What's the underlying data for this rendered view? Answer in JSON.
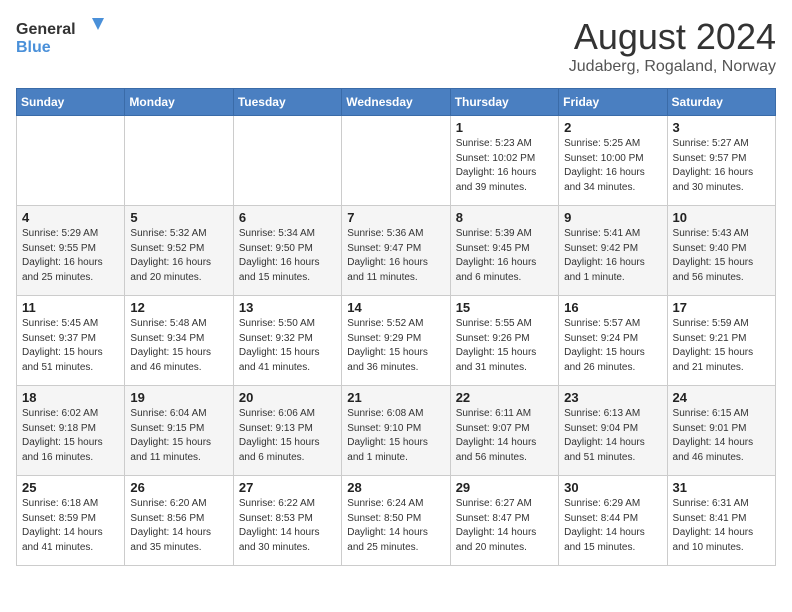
{
  "header": {
    "logo_general": "General",
    "logo_blue": "Blue",
    "month_year": "August 2024",
    "location": "Judaberg, Rogaland, Norway"
  },
  "days_of_week": [
    "Sunday",
    "Monday",
    "Tuesday",
    "Wednesday",
    "Thursday",
    "Friday",
    "Saturday"
  ],
  "weeks": [
    [
      {
        "day": "",
        "info": ""
      },
      {
        "day": "",
        "info": ""
      },
      {
        "day": "",
        "info": ""
      },
      {
        "day": "",
        "info": ""
      },
      {
        "day": "1",
        "info": "Sunrise: 5:23 AM\nSunset: 10:02 PM\nDaylight: 16 hours\nand 39 minutes."
      },
      {
        "day": "2",
        "info": "Sunrise: 5:25 AM\nSunset: 10:00 PM\nDaylight: 16 hours\nand 34 minutes."
      },
      {
        "day": "3",
        "info": "Sunrise: 5:27 AM\nSunset: 9:57 PM\nDaylight: 16 hours\nand 30 minutes."
      }
    ],
    [
      {
        "day": "4",
        "info": "Sunrise: 5:29 AM\nSunset: 9:55 PM\nDaylight: 16 hours\nand 25 minutes."
      },
      {
        "day": "5",
        "info": "Sunrise: 5:32 AM\nSunset: 9:52 PM\nDaylight: 16 hours\nand 20 minutes."
      },
      {
        "day": "6",
        "info": "Sunrise: 5:34 AM\nSunset: 9:50 PM\nDaylight: 16 hours\nand 15 minutes."
      },
      {
        "day": "7",
        "info": "Sunrise: 5:36 AM\nSunset: 9:47 PM\nDaylight: 16 hours\nand 11 minutes."
      },
      {
        "day": "8",
        "info": "Sunrise: 5:39 AM\nSunset: 9:45 PM\nDaylight: 16 hours\nand 6 minutes."
      },
      {
        "day": "9",
        "info": "Sunrise: 5:41 AM\nSunset: 9:42 PM\nDaylight: 16 hours\nand 1 minute."
      },
      {
        "day": "10",
        "info": "Sunrise: 5:43 AM\nSunset: 9:40 PM\nDaylight: 15 hours\nand 56 minutes."
      }
    ],
    [
      {
        "day": "11",
        "info": "Sunrise: 5:45 AM\nSunset: 9:37 PM\nDaylight: 15 hours\nand 51 minutes."
      },
      {
        "day": "12",
        "info": "Sunrise: 5:48 AM\nSunset: 9:34 PM\nDaylight: 15 hours\nand 46 minutes."
      },
      {
        "day": "13",
        "info": "Sunrise: 5:50 AM\nSunset: 9:32 PM\nDaylight: 15 hours\nand 41 minutes."
      },
      {
        "day": "14",
        "info": "Sunrise: 5:52 AM\nSunset: 9:29 PM\nDaylight: 15 hours\nand 36 minutes."
      },
      {
        "day": "15",
        "info": "Sunrise: 5:55 AM\nSunset: 9:26 PM\nDaylight: 15 hours\nand 31 minutes."
      },
      {
        "day": "16",
        "info": "Sunrise: 5:57 AM\nSunset: 9:24 PM\nDaylight: 15 hours\nand 26 minutes."
      },
      {
        "day": "17",
        "info": "Sunrise: 5:59 AM\nSunset: 9:21 PM\nDaylight: 15 hours\nand 21 minutes."
      }
    ],
    [
      {
        "day": "18",
        "info": "Sunrise: 6:02 AM\nSunset: 9:18 PM\nDaylight: 15 hours\nand 16 minutes."
      },
      {
        "day": "19",
        "info": "Sunrise: 6:04 AM\nSunset: 9:15 PM\nDaylight: 15 hours\nand 11 minutes."
      },
      {
        "day": "20",
        "info": "Sunrise: 6:06 AM\nSunset: 9:13 PM\nDaylight: 15 hours\nand 6 minutes."
      },
      {
        "day": "21",
        "info": "Sunrise: 6:08 AM\nSunset: 9:10 PM\nDaylight: 15 hours\nand 1 minute."
      },
      {
        "day": "22",
        "info": "Sunrise: 6:11 AM\nSunset: 9:07 PM\nDaylight: 14 hours\nand 56 minutes."
      },
      {
        "day": "23",
        "info": "Sunrise: 6:13 AM\nSunset: 9:04 PM\nDaylight: 14 hours\nand 51 minutes."
      },
      {
        "day": "24",
        "info": "Sunrise: 6:15 AM\nSunset: 9:01 PM\nDaylight: 14 hours\nand 46 minutes."
      }
    ],
    [
      {
        "day": "25",
        "info": "Sunrise: 6:18 AM\nSunset: 8:59 PM\nDaylight: 14 hours\nand 41 minutes."
      },
      {
        "day": "26",
        "info": "Sunrise: 6:20 AM\nSunset: 8:56 PM\nDaylight: 14 hours\nand 35 minutes."
      },
      {
        "day": "27",
        "info": "Sunrise: 6:22 AM\nSunset: 8:53 PM\nDaylight: 14 hours\nand 30 minutes."
      },
      {
        "day": "28",
        "info": "Sunrise: 6:24 AM\nSunset: 8:50 PM\nDaylight: 14 hours\nand 25 minutes."
      },
      {
        "day": "29",
        "info": "Sunrise: 6:27 AM\nSunset: 8:47 PM\nDaylight: 14 hours\nand 20 minutes."
      },
      {
        "day": "30",
        "info": "Sunrise: 6:29 AM\nSunset: 8:44 PM\nDaylight: 14 hours\nand 15 minutes."
      },
      {
        "day": "31",
        "info": "Sunrise: 6:31 AM\nSunset: 8:41 PM\nDaylight: 14 hours\nand 10 minutes."
      }
    ]
  ]
}
